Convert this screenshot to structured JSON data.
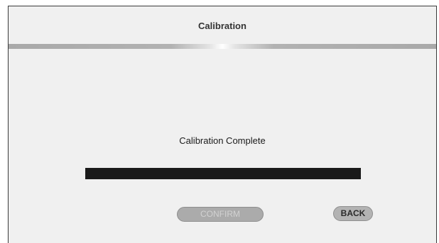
{
  "header": {
    "title": "Calibration"
  },
  "status": {
    "message": "Calibration Complete",
    "progress_fraction": 1.0
  },
  "buttons": {
    "confirm_label": "CONFIRM",
    "confirm_enabled": false,
    "back_label": "BACK"
  },
  "colors": {
    "background": "#f0f0f0",
    "progress_fill": "#1a1a1a",
    "button_fill": "#ababab",
    "divider": "#a9a9a9"
  }
}
